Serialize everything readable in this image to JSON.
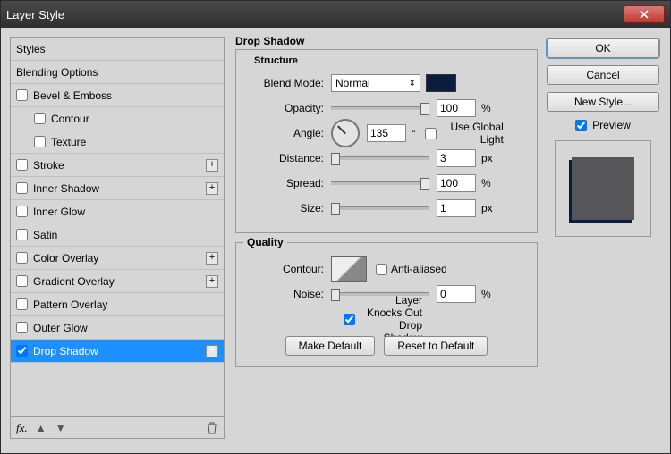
{
  "window": {
    "title": "Layer Style"
  },
  "left": {
    "styles_header": "Styles",
    "blending_options": "Blending Options",
    "items": [
      {
        "label": "Bevel & Emboss",
        "checked": false,
        "plus": false,
        "indent": false
      },
      {
        "label": "Contour",
        "checked": false,
        "plus": false,
        "indent": true
      },
      {
        "label": "Texture",
        "checked": false,
        "plus": false,
        "indent": true
      },
      {
        "label": "Stroke",
        "checked": false,
        "plus": true,
        "indent": false
      },
      {
        "label": "Inner Shadow",
        "checked": false,
        "plus": true,
        "indent": false
      },
      {
        "label": "Inner Glow",
        "checked": false,
        "plus": false,
        "indent": false
      },
      {
        "label": "Satin",
        "checked": false,
        "plus": false,
        "indent": false
      },
      {
        "label": "Color Overlay",
        "checked": false,
        "plus": true,
        "indent": false
      },
      {
        "label": "Gradient Overlay",
        "checked": false,
        "plus": true,
        "indent": false
      },
      {
        "label": "Pattern Overlay",
        "checked": false,
        "plus": false,
        "indent": false
      },
      {
        "label": "Outer Glow",
        "checked": false,
        "plus": false,
        "indent": false
      },
      {
        "label": "Drop Shadow",
        "checked": true,
        "plus": true,
        "indent": false,
        "selected": true
      }
    ],
    "fx_label": "fx."
  },
  "mid": {
    "title": "Drop Shadow",
    "structure_legend": "Structure",
    "blend_mode_label": "Blend Mode:",
    "blend_mode_value": "Normal",
    "blend_color": "#0c1c3c",
    "opacity_label": "Opacity:",
    "opacity_value": "100",
    "opacity_unit": "%",
    "angle_label": "Angle:",
    "angle_value": "135",
    "angle_unit": "°",
    "use_global_light": "Use Global Light",
    "use_global_light_checked": false,
    "distance_label": "Distance:",
    "distance_value": "3",
    "distance_unit": "px",
    "spread_label": "Spread:",
    "spread_value": "100",
    "spread_unit": "%",
    "size_label": "Size:",
    "size_value": "1",
    "size_unit": "px",
    "quality_legend": "Quality",
    "contour_label": "Contour:",
    "anti_aliased": "Anti-aliased",
    "anti_aliased_checked": false,
    "noise_label": "Noise:",
    "noise_value": "0",
    "noise_unit": "%",
    "layer_knocks": "Layer Knocks Out Drop Shadow",
    "layer_knocks_checked": true,
    "make_default": "Make Default",
    "reset_default": "Reset to Default"
  },
  "right": {
    "ok": "OK",
    "cancel": "Cancel",
    "new_style": "New Style...",
    "preview": "Preview",
    "preview_checked": true
  }
}
